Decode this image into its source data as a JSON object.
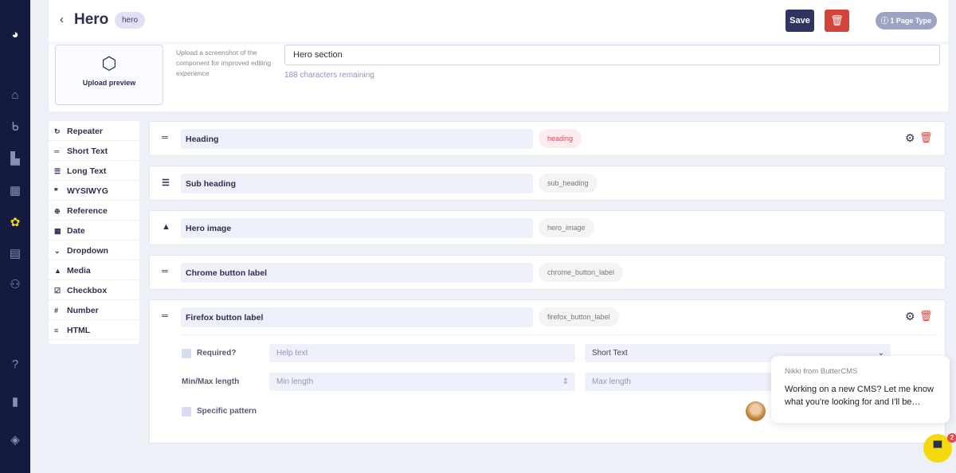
{
  "header": {
    "title": "Hero",
    "slug": "hero",
    "save_label": "Save",
    "page_type_label": "1 Page Type"
  },
  "upload": {
    "label": "Upload preview",
    "hint": "Upload a screenshot of the component for improved editing experience",
    "description_value": "Hero section",
    "remaining": "188 characters remaining"
  },
  "field_types": [
    {
      "icon": "↻",
      "label": "Repeater"
    },
    {
      "icon": "═",
      "label": "Short Text"
    },
    {
      "icon": "☰",
      "label": "Long Text"
    },
    {
      "icon": "❞",
      "label": "WYSIWYG"
    },
    {
      "icon": "⊕",
      "label": "Reference"
    },
    {
      "icon": "▦",
      "label": "Date"
    },
    {
      "icon": "⌄",
      "label": "Dropdown"
    },
    {
      "icon": "▲",
      "label": "Media"
    },
    {
      "icon": "☑",
      "label": "Checkbox"
    },
    {
      "icon": "#",
      "label": "Number"
    },
    {
      "icon": "≡",
      "label": "HTML"
    }
  ],
  "fields": [
    {
      "icon": "═",
      "name": "Heading",
      "key": "heading"
    },
    {
      "icon": "☰",
      "name": "Sub heading",
      "key": "sub_heading"
    },
    {
      "icon": "▲",
      "name": "Hero image",
      "key": "hero_image"
    },
    {
      "icon": "═",
      "name": "Chrome button label",
      "key": "chrome_button_label"
    },
    {
      "icon": "═",
      "name": "Firefox button label",
      "key": "firefox_button_label"
    }
  ],
  "expanded": {
    "required_label": "Required?",
    "help_placeholder": "Help text",
    "type_value": "Short Text",
    "minmax_label": "Min/Max length",
    "min_placeholder": "Min length",
    "max_placeholder": "Max length",
    "pattern_label": "Specific pattern"
  },
  "chat": {
    "from": "Nikki from ButterCMS",
    "message": "Working on a new CMS? Let me know what you're looking for and I'll be…",
    "badge": "2"
  },
  "colors": {
    "sidebar": "#141b3e",
    "save": "#2d3560",
    "delete": "#d2443c",
    "launcher": "#f5d90e"
  }
}
